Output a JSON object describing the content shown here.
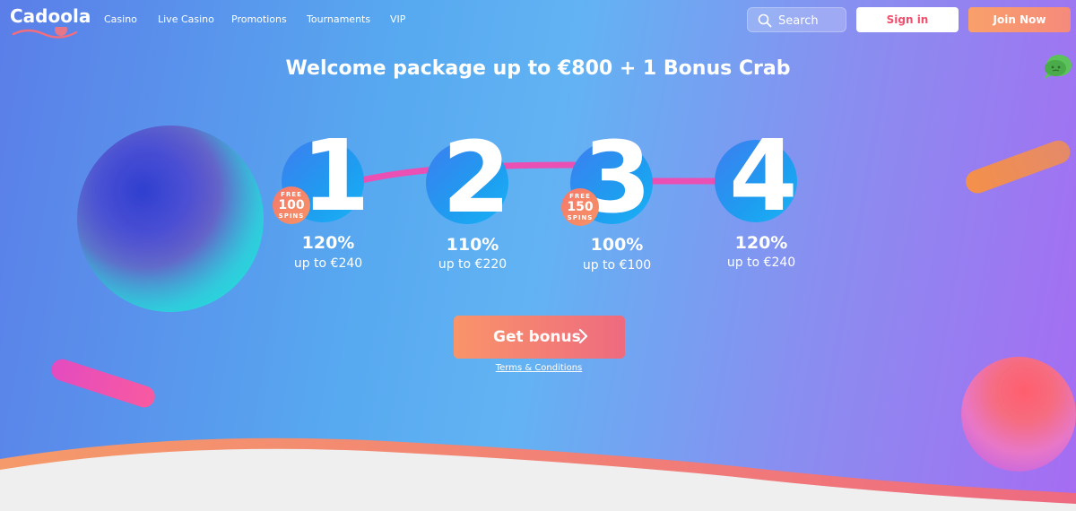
{
  "header": {
    "logo": "Cadoola",
    "nav": [
      "Casino",
      "Live Casino",
      "Promotions",
      "Tournaments",
      "VIP"
    ],
    "search_placeholder": "Search",
    "signin_label": "Sign in",
    "join_label": "Join Now"
  },
  "hero": {
    "headline": "Welcome package up to €800 + 1 Bonus Crab",
    "steps": [
      {
        "digit": "1",
        "percent": "120%",
        "amount": "up to €240",
        "badge": {
          "top": "FREE",
          "num": "100",
          "bottom": "SPINS"
        }
      },
      {
        "digit": "2",
        "percent": "110%",
        "amount": "up to €220"
      },
      {
        "digit": "3",
        "percent": "100%",
        "amount": "up to €100",
        "badge": {
          "top": "FREE",
          "num": "150",
          "bottom": "SPINS"
        }
      },
      {
        "digit": "4",
        "percent": "120%",
        "amount": "up to €240"
      }
    ],
    "cta_label": "Get bonus",
    "terms_label": "Terms & Conditions"
  },
  "icons": {
    "search": "search-icon",
    "chat": "chat-icon",
    "chevron": "chevron-right-icon"
  },
  "colors": {
    "accent_pink": "#f0506e",
    "accent_orange": "#f9946a",
    "bg_blue": "#57a9f0",
    "bg_purple": "#a66cf2"
  }
}
